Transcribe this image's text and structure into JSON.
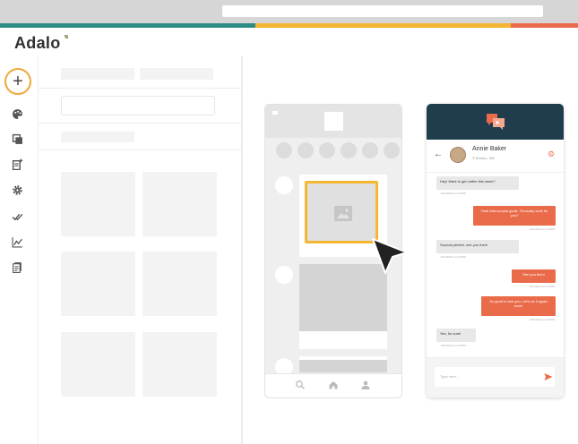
{
  "brand": {
    "logo_text": "Adalo"
  },
  "colors": {
    "teal": "#2e8c86",
    "yellow": "#f5b731",
    "orange": "#ea6b4a",
    "chat_header": "#1f3d4d"
  },
  "sidebar_icons": [
    "add-icon",
    "palette-icon",
    "layers-icon",
    "new-screen-icon",
    "gear-icon",
    "check-icon",
    "analytics-icon",
    "document-icon"
  ],
  "chat": {
    "name": "Annie Baker",
    "location": "Boston, MA",
    "messages": [
      {
        "dir": "in",
        "text": "Hey! Want to get coffee this week?",
        "time": "8/14/2019 at 2:15PM"
      },
      {
        "dir": "out",
        "text": "Yeah that sounds great. Thursday work for you?",
        "time": "8/14/2019 at 2:15PM"
      },
      {
        "dir": "in",
        "text": "Sounds perfect, see you then!",
        "time": "8/14/2019 at 2:15PM"
      },
      {
        "dir": "out",
        "text": "See you then!",
        "time": "8/14/2019 at 2:15PM"
      },
      {
        "dir": "out",
        "text": "So good to see you. Let's do it again soon!",
        "time": "8/15/2019 at 3:15PM"
      },
      {
        "dir": "in",
        "text": "Yes, for sure!",
        "time": "8/15/2019 at 3:15PM"
      }
    ],
    "input_placeholder": "Type here..."
  }
}
